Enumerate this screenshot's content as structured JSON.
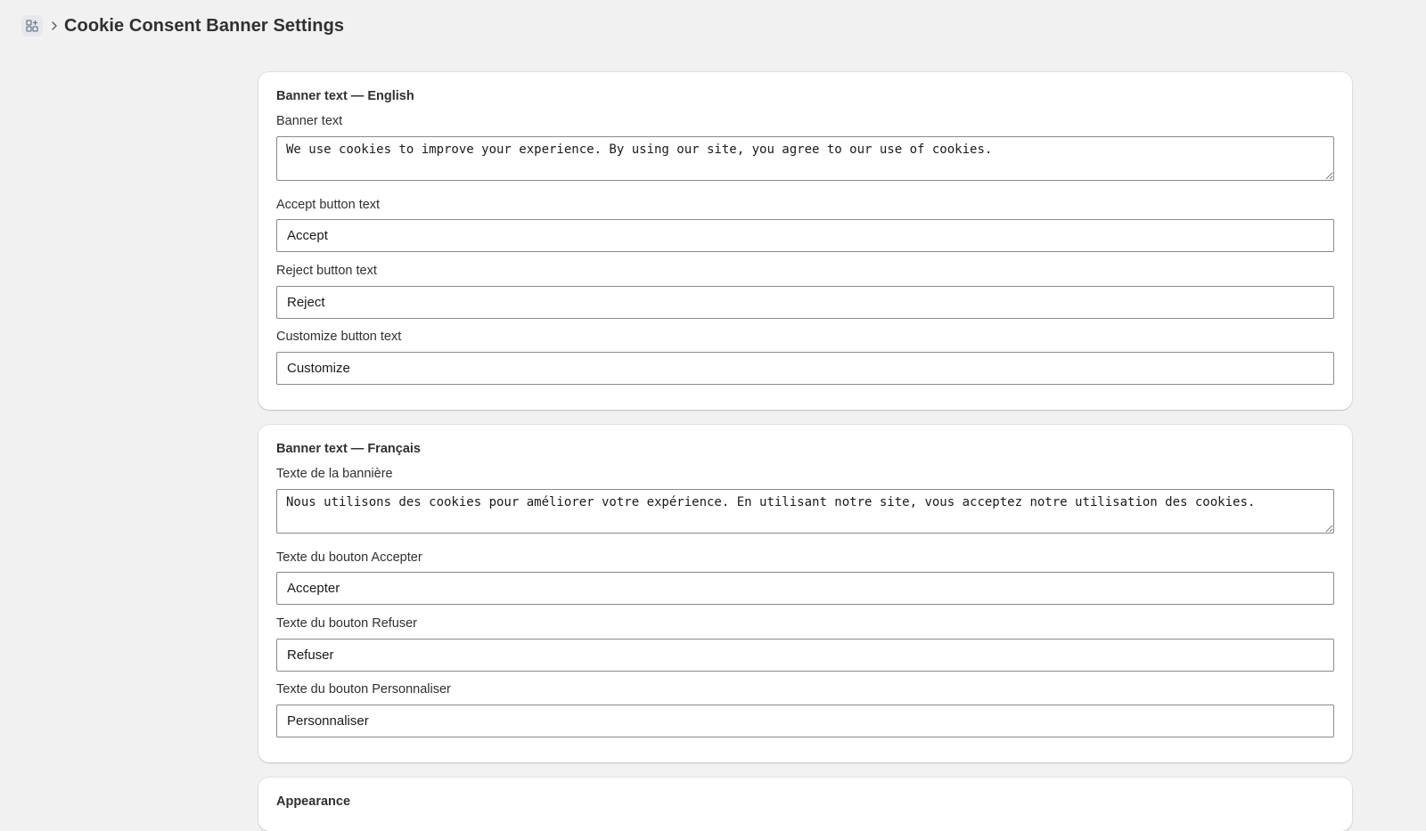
{
  "header": {
    "app_icon": "apps-icon",
    "separator_icon": "chevron-right-icon",
    "title": "Cookie Consent Banner Settings"
  },
  "english": {
    "heading": "Banner text — English",
    "banner_label": "Banner text",
    "banner_value": "We use cookies to improve your experience. By using our site, you agree to our use of cookies.",
    "accept_label": "Accept button text",
    "accept_value": "Accept",
    "reject_label": "Reject button text",
    "reject_value": "Reject",
    "customize_label": "Customize button text",
    "customize_value": "Customize"
  },
  "french": {
    "heading": "Banner text — Français",
    "banner_label": "Texte de la bannière",
    "banner_value": "Nous utilisons des cookies pour améliorer votre expérience. En utilisant notre site, vous acceptez notre utilisation des cookies.",
    "accept_label": "Texte du bouton Accepter",
    "accept_value": "Accepter",
    "reject_label": "Texte du bouton Refuser",
    "reject_value": "Refuser",
    "customize_label": "Texte du bouton Personnaliser",
    "customize_value": "Personnaliser"
  },
  "appearance": {
    "heading": "Appearance"
  }
}
